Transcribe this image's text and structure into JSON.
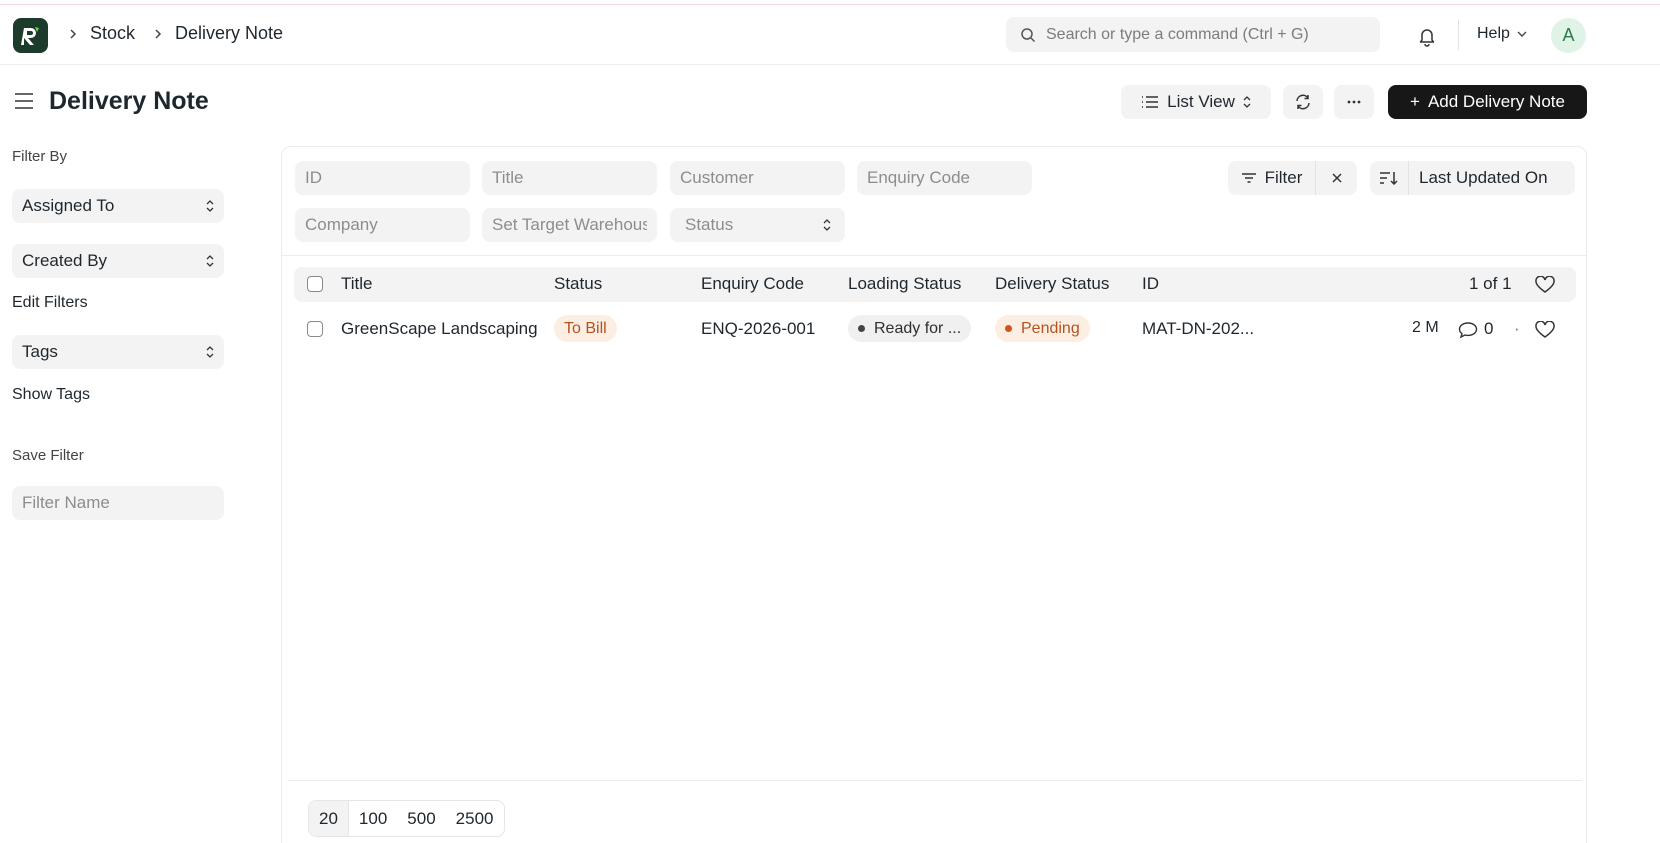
{
  "navbar": {
    "breadcrumbs": [
      "Stock",
      "Delivery Note"
    ],
    "search_placeholder": "Search or type a command (Ctrl + G)",
    "help_label": "Help",
    "avatar_initial": "A"
  },
  "page": {
    "title": "Delivery Note",
    "list_view_label": "List View",
    "add_button_label": "Add Delivery Note"
  },
  "sidebar": {
    "filter_by_label": "Filter By",
    "assigned_to": "Assigned To",
    "created_by": "Created By",
    "edit_filters": "Edit Filters",
    "tags": "Tags",
    "show_tags": "Show Tags",
    "save_filter_label": "Save Filter",
    "filter_name_placeholder": "Filter Name"
  },
  "filters": {
    "id_placeholder": "ID",
    "title_placeholder": "Title",
    "customer_placeholder": "Customer",
    "enquiry_code_placeholder": "Enquiry Code",
    "company_placeholder": "Company",
    "target_warehouse_placeholder": "Set Target Warehouse",
    "status_placeholder": "Status",
    "filter_button": "Filter",
    "sort_label": "Last Updated On"
  },
  "table": {
    "columns": [
      "Title",
      "Status",
      "Enquiry Code",
      "Loading Status",
      "Delivery Status",
      "ID"
    ],
    "count_label": "1 of 1",
    "rows": [
      {
        "title": "GreenScape Landscaping",
        "status": "To Bill",
        "enquiry_code": "ENQ-2026-001",
        "loading_status": "Ready for ...",
        "delivery_status": "Pending",
        "id": "MAT-DN-202...",
        "modified": "2 M",
        "comments": "0"
      }
    ]
  },
  "pagination": {
    "page_sizes": [
      "20",
      "100",
      "500",
      "2500"
    ],
    "selected": "20"
  },
  "colors": {
    "primary_button": "#171717",
    "logo_bg": "#1c3b2b",
    "status_orange_bg": "#fdeee3",
    "status_orange_text": "#b4531e"
  }
}
